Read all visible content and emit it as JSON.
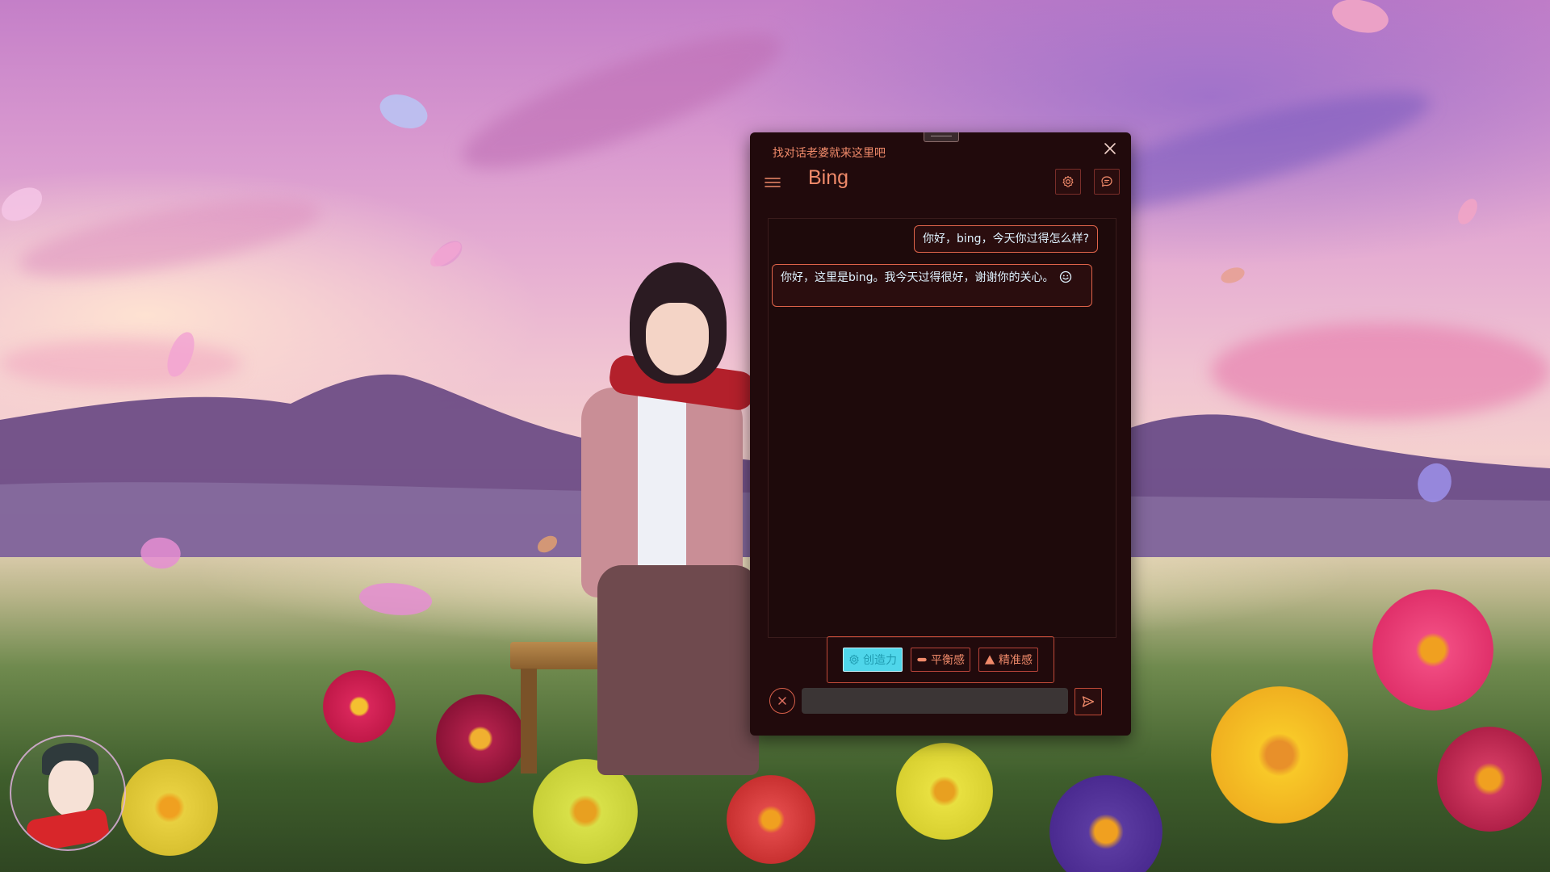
{
  "window": {
    "title": "找对话老婆就来这里吧",
    "app_name": "Bing"
  },
  "icons": {
    "close": "close-icon",
    "menu": "hamburger-menu-icon",
    "settings": "gear-icon",
    "chat_history": "chat-bubble-icon",
    "clear": "close-circle-icon",
    "send": "send-icon",
    "smile": "smiley-icon"
  },
  "messages": [
    {
      "role": "user",
      "text": "你好，bing，今天你过得怎么样?"
    },
    {
      "role": "assistant",
      "text": "你好，这里是bing。我今天过得很好，谢谢你的关心。"
    }
  ],
  "modes": {
    "creative": {
      "label": "创造力",
      "active": true
    },
    "balanced": {
      "label": "平衡感",
      "active": false
    },
    "precise": {
      "label": "精准感",
      "active": false
    }
  },
  "input": {
    "value": "",
    "placeholder": ""
  },
  "colors": {
    "window_bg": "#210a0c",
    "accent": "#f08a6a",
    "border": "#e0644a",
    "active_mode_bg": "#4fd6ea",
    "bubble_text": "#dff3ff"
  }
}
